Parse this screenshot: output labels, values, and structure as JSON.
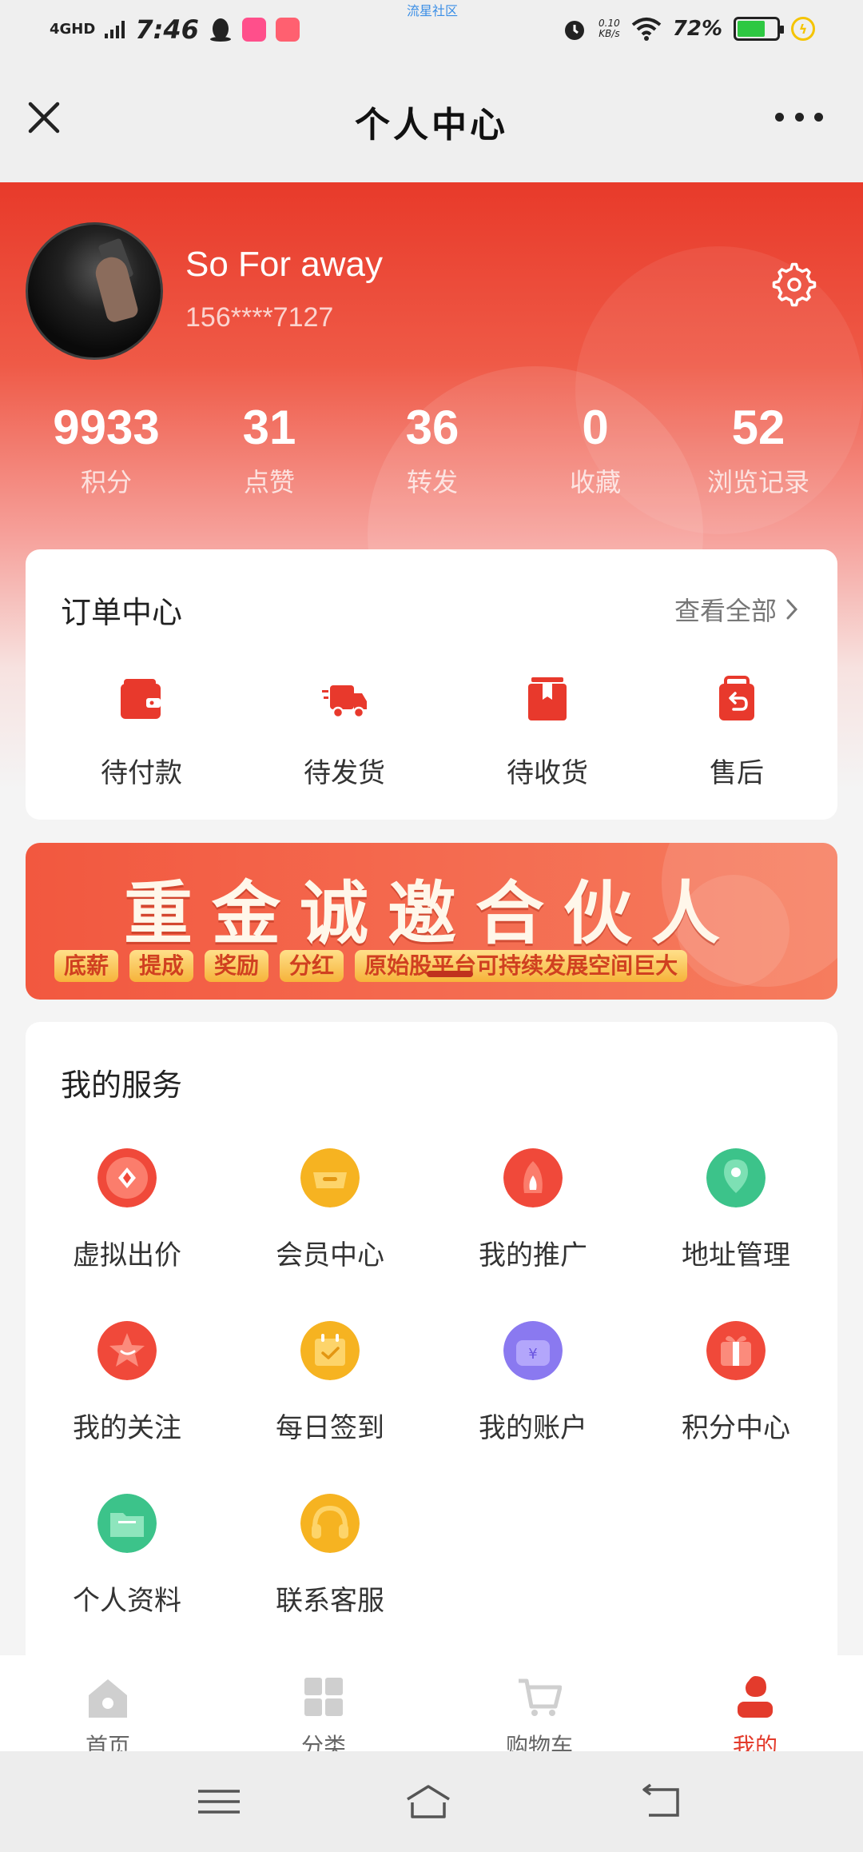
{
  "status_bar": {
    "network": "4GHD",
    "time": "7:46",
    "carrier_tag": "流星社区",
    "speed_value": "0.10",
    "speed_unit": "KB/s",
    "battery": "72%",
    "battery_level": 0.72
  },
  "title_bar": {
    "title": "个人中心"
  },
  "profile": {
    "username": "So For away",
    "phone": "156****7127"
  },
  "stats": [
    {
      "value": "9933",
      "label": "积分"
    },
    {
      "value": "31",
      "label": "点赞"
    },
    {
      "value": "36",
      "label": "转发"
    },
    {
      "value": "0",
      "label": "收藏"
    },
    {
      "value": "52",
      "label": "浏览记录"
    }
  ],
  "orders": {
    "title": "订单中心",
    "view_all": "查看全部",
    "items": [
      {
        "label": "待付款",
        "icon": "wallet-icon"
      },
      {
        "label": "待发货",
        "icon": "truck-icon"
      },
      {
        "label": "待收货",
        "icon": "package-icon"
      },
      {
        "label": "售后",
        "icon": "return-bag-icon"
      }
    ]
  },
  "banner": {
    "title": "重金诚邀合伙人",
    "tags": [
      "底薪",
      "提成",
      "奖励",
      "分红",
      "原始股平台可持续发展空间巨大"
    ]
  },
  "services": {
    "title": "我的服务",
    "items": [
      {
        "label": "虚拟出价",
        "icon": "virtual-bid-icon",
        "color": "#f0493a"
      },
      {
        "label": "会员中心",
        "icon": "member-icon",
        "color": "#f6b321"
      },
      {
        "label": "我的推广",
        "icon": "promotion-icon",
        "color": "#f0493a"
      },
      {
        "label": "地址管理",
        "icon": "location-icon",
        "color": "#3cc38a"
      },
      {
        "label": "我的关注",
        "icon": "star-icon",
        "color": "#f0493a"
      },
      {
        "label": "每日签到",
        "icon": "calendar-check-icon",
        "color": "#f6b321"
      },
      {
        "label": "我的账户",
        "icon": "wallet-yen-icon",
        "color": "#8a79f0"
      },
      {
        "label": "积分中心",
        "icon": "gift-icon",
        "color": "#f0493a"
      },
      {
        "label": "个人资料",
        "icon": "folder-icon",
        "color": "#3cc38a"
      },
      {
        "label": "联系客服",
        "icon": "headset-icon",
        "color": "#f6b321"
      }
    ]
  },
  "tabbar": {
    "tabs": [
      {
        "label": "首页",
        "icon": "home-icon"
      },
      {
        "label": "分类",
        "icon": "category-icon"
      },
      {
        "label": "购物车",
        "icon": "cart-icon"
      },
      {
        "label": "我的",
        "icon": "profile-icon"
      }
    ],
    "active_color": "#e33b2c"
  },
  "colors": {
    "accent": "#e83a2a",
    "icon_red": "#e8392c"
  }
}
